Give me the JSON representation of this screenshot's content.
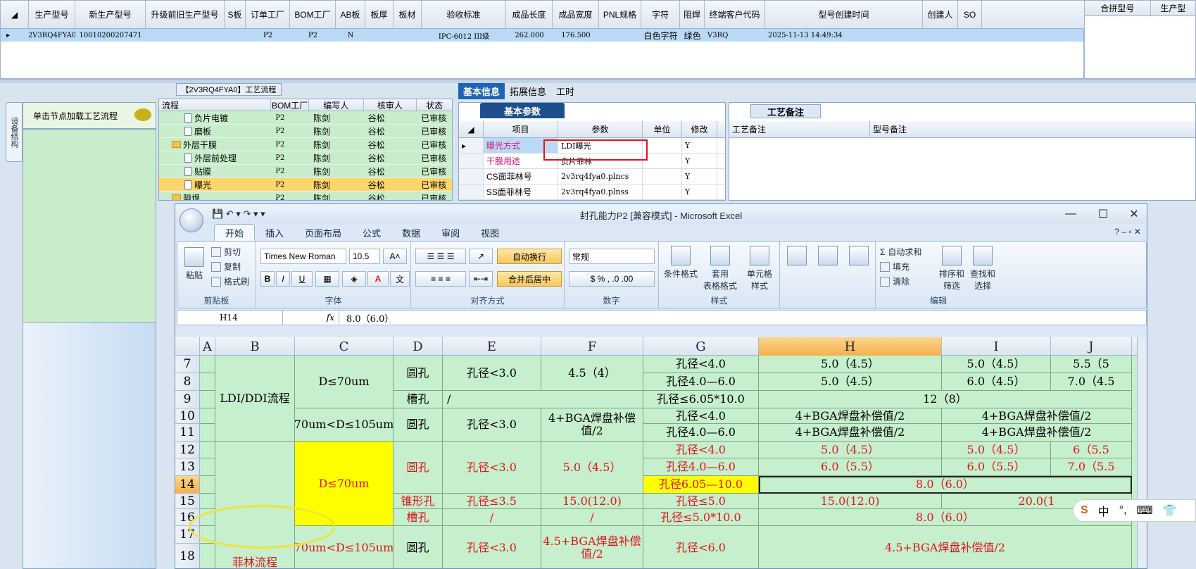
{
  "top_grid": {
    "headers": [
      "生产型号",
      "新生产型号",
      "升级前旧生产型号",
      "S板",
      "订单工厂",
      "BOM工厂",
      "AB板",
      "板厚",
      "板材",
      "验收标准",
      "成品长度",
      "成品宽度",
      "PNL规格",
      "字符",
      "阻焊",
      "终端客户代码",
      "型号创建时间",
      "创建人",
      "SO"
    ],
    "row": [
      "2V3RQ4FYA0",
      "10010200207471",
      "",
      "",
      "P2",
      "P2",
      "N",
      "",
      "",
      "IPC-6012 III级",
      "262.000",
      "176.500",
      "",
      "白色字符",
      "绿色",
      "V3RQ",
      "2025-11-13 14:49:34",
      "",
      ""
    ]
  },
  "merge_panel": {
    "headers": [
      "合拼型号",
      "生产型"
    ]
  },
  "left_sidebar": {
    "vertical_tab": "设备结构",
    "load_hint": "单击节点加载工艺流程"
  },
  "flow": {
    "title": "【2V3RQ4FYA0】工艺流程",
    "headers": [
      "流程",
      "BOM工厂",
      "编写人",
      "核审人",
      "状态"
    ],
    "rows": [
      {
        "name": "负片电镀",
        "factory": "P2",
        "writer": "陈剑",
        "reviewer": "谷松",
        "status": "已审核",
        "type": "doc",
        "indent": 2
      },
      {
        "name": "磨板",
        "factory": "P2",
        "writer": "陈剑",
        "reviewer": "谷松",
        "status": "已审核",
        "type": "doc",
        "indent": 2
      },
      {
        "name": "外层干膜",
        "factory": "P2",
        "writer": "陈剑",
        "reviewer": "谷松",
        "status": "已审核",
        "type": "folder",
        "indent": 1
      },
      {
        "name": "外层前处理",
        "factory": "P2",
        "writer": "陈剑",
        "reviewer": "谷松",
        "status": "已审核",
        "type": "doc",
        "indent": 2
      },
      {
        "name": "贴膜",
        "factory": "P2",
        "writer": "陈剑",
        "reviewer": "谷松",
        "status": "已审核",
        "type": "doc",
        "indent": 2
      },
      {
        "name": "曝光",
        "factory": "P2",
        "writer": "陈剑",
        "reviewer": "谷松",
        "status": "已审核",
        "type": "doc",
        "indent": 2,
        "selected": true
      },
      {
        "name": "阻焊",
        "factory": "P2",
        "writer": "陈剑",
        "reviewer": "谷松",
        "status": "已审核",
        "type": "folder",
        "indent": 1
      }
    ]
  },
  "right_tabs": [
    "基本信息",
    "拓展信息",
    "工时"
  ],
  "basic_params": {
    "title": "基本参数",
    "headers": [
      "项目",
      "参数",
      "单位",
      "修改"
    ],
    "rows": [
      {
        "item": "曝光方式",
        "value": "LDI曝光",
        "unit": "",
        "edit": "Y",
        "red": true
      },
      {
        "item": "干膜用途",
        "value": "负片菲林",
        "unit": "",
        "edit": "Y",
        "red": true
      },
      {
        "item": "CS面菲林号",
        "value": "2v3rq4fya0.plncs",
        "unit": "",
        "edit": "Y",
        "red": false
      },
      {
        "item": "SS面菲林号",
        "value": "2v3rq4fya0.plnss",
        "unit": "",
        "edit": "Y",
        "red": false
      }
    ]
  },
  "remarks": {
    "title": "工艺备注",
    "headers": [
      "工艺备注",
      "型号备注"
    ]
  },
  "excel": {
    "title": "封孔能力P2  [兼容模式] - Microsoft Excel",
    "ribbon_tabs": [
      "开始",
      "插入",
      "页面布局",
      "公式",
      "数据",
      "审阅",
      "视图"
    ],
    "clipboard": {
      "paste": "粘贴",
      "cut": "剪切",
      "copy": "复制",
      "format_painter": "格式刷",
      "group": "剪贴板"
    },
    "font": {
      "name": "Times New Roman",
      "size": "10.5",
      "group": "字体",
      "bold": "B",
      "italic": "I",
      "underline": "U"
    },
    "align": {
      "wrap": "自动换行",
      "merge": "合并后居中",
      "group": "对齐方式"
    },
    "number": {
      "format": "常规",
      "group": "数字"
    },
    "styles": {
      "cond": "条件格式",
      "table": "套用\n表格格式",
      "cell": "单元格\n样式",
      "group": "样式"
    },
    "cells": {
      "b_ldi": "LDI/DDI流程",
      "c_d70": "D≤70um",
      "d_round": "圆孔",
      "e_lt30": "孔径<3.0",
      "f_45_4": "4.5（4）",
      "g7": "孔径<4.0",
      "h7": "5.0（4.5）",
      "i7": "5.0（4.5）",
      "j7": "5.5（5",
      "g8": "孔径4.0—6.0",
      "h8": "5.0（4.5）",
      "i8": "6.0（4.5）",
      "j8": "7.0（4.5",
      "d9": "槽孔",
      "e9": "/",
      "g9": "孔径≤6.05*10.0",
      "h9": "12（8）",
      "c10": "70um<D≤105um",
      "d10": "圆孔",
      "e10": "孔径<3.0",
      "f10": "4+BGA焊盘补偿值/2",
      "g10": "孔径<4.0",
      "h10": "4+BGA焊盘补偿值/2",
      "i10": "4+BGA焊盘补偿值/2",
      "g11": "孔径4.0—6.0",
      "h11": "4+BGA焊盘补偿值/2",
      "i11": "4+BGA焊盘补偿值/2",
      "c12": "D≤70um",
      "d12": "圆孔",
      "e12": "孔径<3.0",
      "f12": "5.0（4.5）",
      "g12": "孔径<4.0",
      "h12": "5.0（4.5）",
      "i12": "5.0（4.5）",
      "j12": "6（5.5",
      "g13": "孔径4.0—6.0",
      "h13": "6.0（5.5）",
      "i13": "6.0（5.5）",
      "j13": "7.0（5.5",
      "g14": "孔径6.05—10.0",
      "h14": "8.0（6.0）",
      "d15": "锥形孔",
      "e15": "孔径≤3.5",
      "f15": "15.0(12.0)",
      "g15": "孔径≤5.0",
      "h15": "15.0(12.0)",
      "i15": "20.0(1",
      "b_film": "菲林流程",
      "d16": "槽孔",
      "e16": "/",
      "f16": "/",
      "g16": "孔径≤5.0*10.0",
      "h16": "8.0（6.0）",
      "c17": "70um<D≤105um",
      "d17": "圆孔",
      "e17": "孔径<3.0",
      "f17": "4.5+BGA焊盘补偿值/2",
      "g17": "孔径<6.0",
      "h17": "4.5+BGA焊盘补偿值/2"
    },
    "edit": {
      "autosum": "自动求和",
      "fill": "填充",
      "clear": "清除",
      "sort": "排序和\n筛选",
      "find": "查找和\n选择",
      "group": "编辑"
    },
    "namebox": "H14",
    "fx": "fx",
    "formula": "8.0（6.0）",
    "columns": [
      "A",
      "B",
      "C",
      "D",
      "E",
      "F",
      "G",
      "H",
      "I",
      "J"
    ],
    "rows": [
      "7",
      "8",
      "9",
      "10",
      "11",
      "12",
      "13",
      "14",
      "15",
      "16",
      "17",
      "18"
    ]
  },
  "ime": {
    "logo": "S",
    "lang": "中",
    "punct": "°,"
  }
}
